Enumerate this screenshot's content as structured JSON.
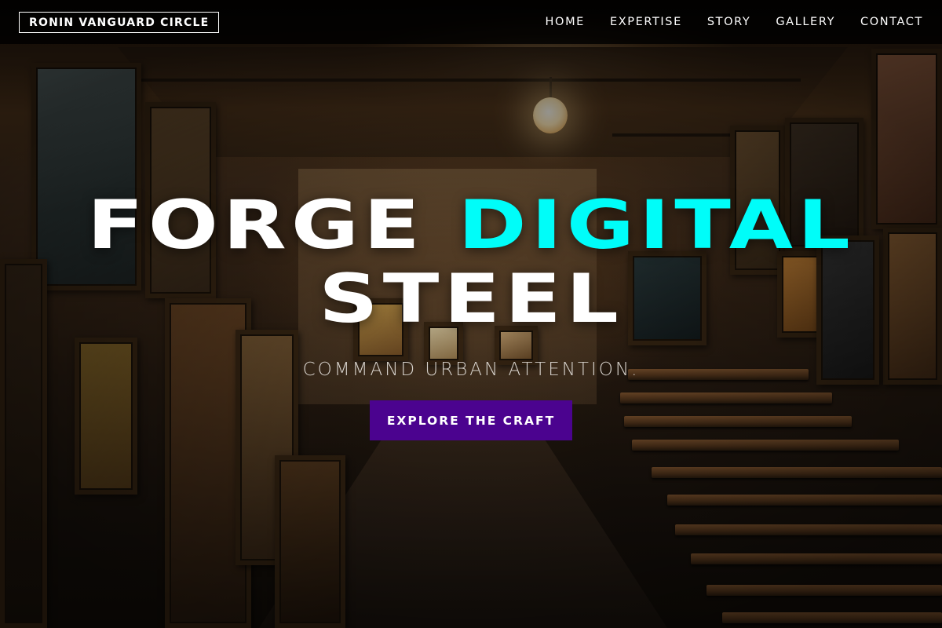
{
  "nav": {
    "brand": "RONIN VANGUARD CIRCLE",
    "links": [
      {
        "label": "HOME"
      },
      {
        "label": "EXPERTISE"
      },
      {
        "label": "STORY"
      },
      {
        "label": "GALLERY"
      },
      {
        "label": "CONTACT"
      }
    ]
  },
  "hero": {
    "headline_part1": "FORGE",
    "headline_accent": "DIGITAL",
    "headline_line2": "STEEL",
    "tagline": "COMMAND URBAN ATTENTION.",
    "cta_label": "EXPLORE THE CRAFT",
    "background": "art-storage-room-photo"
  },
  "colors": {
    "accent": "#00fdf9",
    "button": "#4b038f",
    "nav_background": "#000000",
    "text": "#ffffff"
  }
}
